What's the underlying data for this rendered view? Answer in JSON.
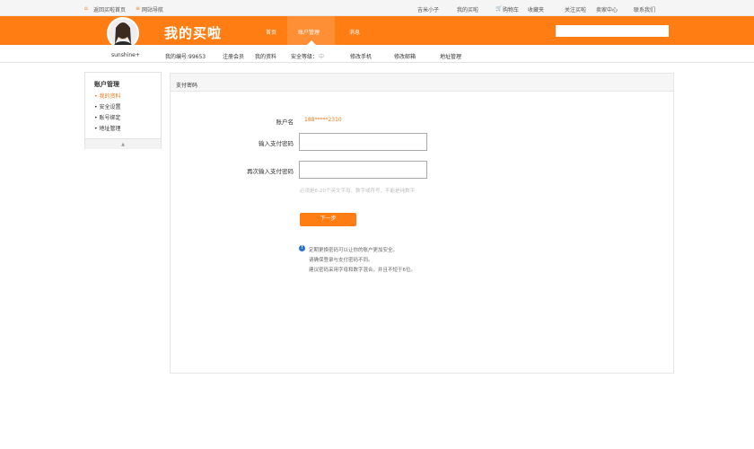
{
  "topbar": {
    "home_link": "返回买啦首页",
    "site_nav": "网站导航",
    "user": "吉米小子",
    "my_maila": "我的买啦",
    "cart": "购物车",
    "favorites": "收藏夹",
    "follow": "关注买啦",
    "seller_center": "卖家中心",
    "contact": "联系我们"
  },
  "header": {
    "brand": "我的买啦",
    "nav": [
      "首页",
      "账户管理",
      "消息"
    ],
    "active_nav": "账户管理",
    "search_placeholder": ""
  },
  "subbar": {
    "username": "sunshine+",
    "account_no": "我的编号:99653",
    "items": [
      "注册会员",
      "我的资料",
      "安全等级：",
      "修改手机",
      "修改邮箱",
      "地址管理"
    ],
    "security_level": "中"
  },
  "sidebar": {
    "title": "账户管理",
    "items": [
      "• 我的资料",
      "• 安全设置",
      "• 账号绑定",
      "• 地址管理"
    ],
    "collapse_arrow": "▲"
  },
  "panel": {
    "title": "支付密码",
    "account_label": "账户名",
    "account_value": "188*****2310",
    "pwd_label": "输入支付密码",
    "pwd_confirm_label": "再次输入支付密码",
    "hint": "必须是6-20个英文字母、数字或符号，不能是纯数字",
    "next_button": "下一步",
    "tips": [
      "定期更换密码可以让你的账户更加安全。",
      "请确保登录与支付密码不同。",
      "建议密码采用字母和数字混合，并且不短于6位。"
    ]
  },
  "colors": {
    "accent": "#ff7d12",
    "info": "#2a6fd6"
  }
}
